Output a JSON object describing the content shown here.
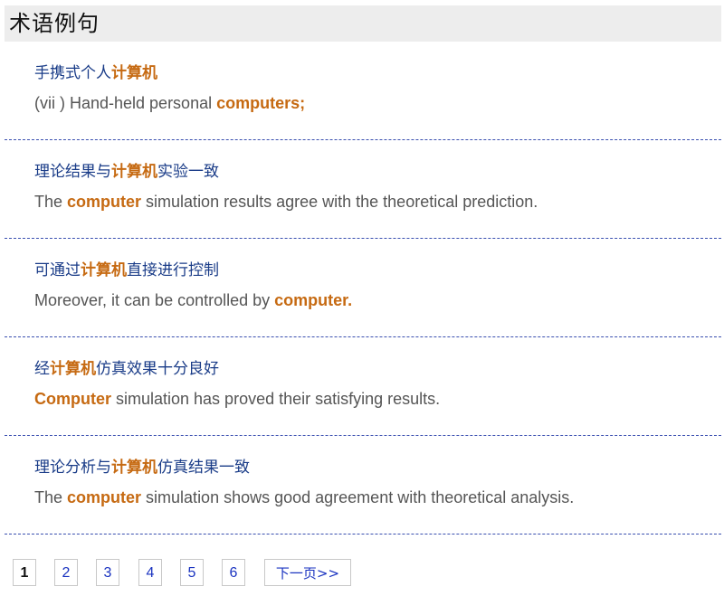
{
  "header": {
    "title": "术语例句"
  },
  "entries": [
    {
      "zh_before": "手携式个人",
      "zh_term": "计算机",
      "zh_after": "",
      "en_before": "(vii ) Hand-held personal ",
      "en_term": "computers;",
      "en_after": ""
    },
    {
      "zh_before": "理论结果与",
      "zh_term": "计算机",
      "zh_after": "实验一致",
      "en_before": "The ",
      "en_term": "computer",
      "en_after": " simulation results agree with the theoretical prediction."
    },
    {
      "zh_before": "可通过",
      "zh_term": "计算机",
      "zh_after": "直接进行控制",
      "en_before": "Moreover, it can be controlled by ",
      "en_term": "computer.",
      "en_after": ""
    },
    {
      "zh_before": "经",
      "zh_term": "计算机",
      "zh_after": "仿真效果十分良好",
      "en_before": "",
      "en_term": "Computer",
      "en_after": " simulation has proved their satisfying results."
    },
    {
      "zh_before": "理论分析与",
      "zh_term": "计算机",
      "zh_after": "仿真结果一致",
      "en_before": "The ",
      "en_term": "computer",
      "en_after": " simulation shows good agreement with theoretical analysis."
    }
  ],
  "pagination": {
    "current": "1",
    "pages": [
      "2",
      "3",
      "4",
      "5",
      "6"
    ],
    "next_label": "下一页>>"
  },
  "colors": {
    "term_highlight": "#c66a12",
    "chinese_text": "#1a3c88",
    "english_text": "#555555",
    "divider": "#3a4fb0",
    "link": "#1a33c0"
  }
}
